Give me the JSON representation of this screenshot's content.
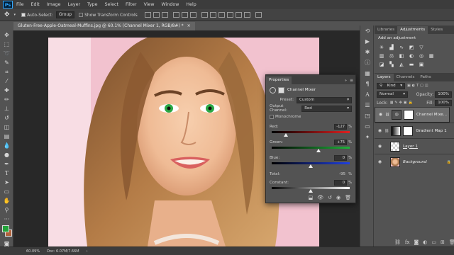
{
  "app": {
    "logo": "Ps"
  },
  "menu": [
    "File",
    "Edit",
    "Image",
    "Layer",
    "Type",
    "Select",
    "Filter",
    "View",
    "Window",
    "Help"
  ],
  "options": {
    "auto_select_label": "Auto-Select:",
    "auto_select_value": "Group",
    "transform_label": "Show Transform Controls"
  },
  "document": {
    "tab_title": "Gluten-Free-Apple-Oatmeal-Muffins.jpg @ 60.1% (Channel Mixer 1, RGB/8#) *",
    "close": "×"
  },
  "status": {
    "zoom": "60.09%",
    "doc": "Doc: 6.07M/7.66M"
  },
  "panels": {
    "top_tabs": [
      "Libraries",
      "Adjustments",
      "Styles"
    ],
    "adjust_title": "Add an adjustment",
    "layer_tabs": [
      "Layers",
      "Channels",
      "Paths"
    ],
    "kind": "Kind",
    "blend": "Normal",
    "opacity_label": "Opacity:",
    "opacity": "100%",
    "lock_label": "Lock:",
    "fill_label": "Fill:",
    "fill": "100%",
    "layers": [
      {
        "name": "Channel Mixe..."
      },
      {
        "name": "Gradient Map 1"
      },
      {
        "name": "Layer 1"
      },
      {
        "name": "Background"
      }
    ]
  },
  "properties": {
    "tab": "Properties",
    "title": "Channel Mixer",
    "preset_label": "Preset:",
    "preset_value": "Custom",
    "output_label": "Output Channel:",
    "output_value": "Red",
    "monochrome": "Monochrome",
    "red_label": "Red:",
    "red_value": "-127",
    "red_frac": 0.18,
    "green_label": "Green:",
    "green_value": "+75",
    "green_frac": 0.6,
    "blue_label": "Blue:",
    "blue_value": "0",
    "blue_frac": 0.5,
    "total_label": "Total:",
    "total_value": "-95",
    "constant_label": "Constant:",
    "constant_value": "0",
    "constant_frac": 0.5,
    "pct": "%"
  },
  "colors": {
    "fg": "#22a33a",
    "bg": "#b0623a",
    "accent": "#31a8ff"
  }
}
